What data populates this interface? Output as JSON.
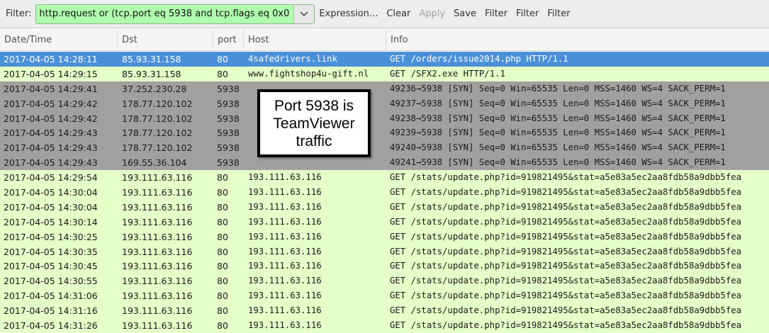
{
  "toolbar": {
    "filter_label": "Filter:",
    "filter_value": "http.request or (tcp.port eq 5938 and tcp.flags eq 0x0",
    "dropdown_icon": "chevron-down-icon",
    "buttons": [
      {
        "label": "Expression...",
        "enabled": true
      },
      {
        "label": "Clear",
        "enabled": true
      },
      {
        "label": "Apply",
        "enabled": false
      },
      {
        "label": "Save",
        "enabled": true
      },
      {
        "label": "Filter",
        "enabled": true
      },
      {
        "label": "Filter",
        "enabled": true
      },
      {
        "label": "Filter",
        "enabled": true
      }
    ]
  },
  "columns": [
    "Date/Time",
    "Dst",
    "port",
    "Host",
    "Info"
  ],
  "row_colors": {
    "selected": "#4a90d9",
    "http": "#e4ffc7",
    "tcp_syn": "#a0a0a0"
  },
  "rows": [
    {
      "date": "2017-04-05 14:28:11",
      "dst": "85.93.31.158",
      "port": "80",
      "host": "4safedrivers.link",
      "info": "GET /orders/issue2014.php HTTP/1.1",
      "style": "selected"
    },
    {
      "date": "2017-04-05 14:29:15",
      "dst": "85.93.31.158",
      "port": "80",
      "host": "www.fightshop4u-gift.nl",
      "info": "GET /SFX2.exe HTTP/1.1",
      "style": "http"
    },
    {
      "date": "2017-04-05 14:29:41",
      "dst": "37.252.230.28",
      "port": "5938",
      "host": "",
      "info": "49236→5938 [SYN] Seq=0 Win=65535 Len=0 MSS=1460 WS=4 SACK_PERM=1",
      "style": "tcp_syn"
    },
    {
      "date": "2017-04-05 14:29:42",
      "dst": "178.77.120.102",
      "port": "5938",
      "host": "",
      "info": "49237→5938 [SYN] Seq=0 Win=65535 Len=0 MSS=1460 WS=4 SACK_PERM=1",
      "style": "tcp_syn"
    },
    {
      "date": "2017-04-05 14:29:42",
      "dst": "178.77.120.102",
      "port": "5938",
      "host": "",
      "info": "49238→5938 [SYN] Seq=0 Win=65535 Len=0 MSS=1460 WS=4 SACK_PERM=1",
      "style": "tcp_syn"
    },
    {
      "date": "2017-04-05 14:29:43",
      "dst": "178.77.120.102",
      "port": "5938",
      "host": "",
      "info": "49239→5938 [SYN] Seq=0 Win=65535 Len=0 MSS=1460 WS=4 SACK_PERM=1",
      "style": "tcp_syn"
    },
    {
      "date": "2017-04-05 14:29:43",
      "dst": "178.77.120.102",
      "port": "5938",
      "host": "",
      "info": "49240→5938 [SYN] Seq=0 Win=65535 Len=0 MSS=1460 WS=4 SACK_PERM=1",
      "style": "tcp_syn"
    },
    {
      "date": "2017-04-05 14:29:43",
      "dst": "169.55.36.104",
      "port": "5938",
      "host": "",
      "info": "49241→5938 [SYN] Seq=0 Win=65535 Len=0 MSS=1460 WS=4 SACK_PERM=1",
      "style": "tcp_syn"
    },
    {
      "date": "2017-04-05 14:29:54",
      "dst": "193.111.63.116",
      "port": "80",
      "host": "193.111.63.116",
      "info": "GET /stats/update.php?id=919821495&stat=a5e83a5ec2aa8fdb58a9dbb5fea",
      "style": "http"
    },
    {
      "date": "2017-04-05 14:30:04",
      "dst": "193.111.63.116",
      "port": "80",
      "host": "193.111.63.116",
      "info": "GET /stats/update.php?id=919821495&stat=a5e83a5ec2aa8fdb58a9dbb5fea",
      "style": "http"
    },
    {
      "date": "2017-04-05 14:30:04",
      "dst": "193.111.63.116",
      "port": "80",
      "host": "193.111.63.116",
      "info": "GET /stats/update.php?id=919821495&stat=a5e83a5ec2aa8fdb58a9dbb5fea",
      "style": "http"
    },
    {
      "date": "2017-04-05 14:30:14",
      "dst": "193.111.63.116",
      "port": "80",
      "host": "193.111.63.116",
      "info": "GET /stats/update.php?id=919821495&stat=a5e83a5ec2aa8fdb58a9dbb5fea",
      "style": "http"
    },
    {
      "date": "2017-04-05 14:30:25",
      "dst": "193.111.63.116",
      "port": "80",
      "host": "193.111.63.116",
      "info": "GET /stats/update.php?id=919821495&stat=a5e83a5ec2aa8fdb58a9dbb5fea",
      "style": "http"
    },
    {
      "date": "2017-04-05 14:30:35",
      "dst": "193.111.63.116",
      "port": "80",
      "host": "193.111.63.116",
      "info": "GET /stats/update.php?id=919821495&stat=a5e83a5ec2aa8fdb58a9dbb5fea",
      "style": "http"
    },
    {
      "date": "2017-04-05 14:30:45",
      "dst": "193.111.63.116",
      "port": "80",
      "host": "193.111.63.116",
      "info": "GET /stats/update.php?id=919821495&stat=a5e83a5ec2aa8fdb58a9dbb5fea",
      "style": "http"
    },
    {
      "date": "2017-04-05 14:30:55",
      "dst": "193.111.63.116",
      "port": "80",
      "host": "193.111.63.116",
      "info": "GET /stats/update.php?id=919821495&stat=a5e83a5ec2aa8fdb58a9dbb5fea",
      "style": "http"
    },
    {
      "date": "2017-04-05 14:31:06",
      "dst": "193.111.63.116",
      "port": "80",
      "host": "193.111.63.116",
      "info": "GET /stats/update.php?id=919821495&stat=a5e83a5ec2aa8fdb58a9dbb5fea",
      "style": "http"
    },
    {
      "date": "2017-04-05 14:31:16",
      "dst": "193.111.63.116",
      "port": "80",
      "host": "193.111.63.116",
      "info": "GET /stats/update.php?id=919821495&stat=a5e83a5ec2aa8fdb58a9dbb5fea",
      "style": "http"
    },
    {
      "date": "2017-04-05 14:31:26",
      "dst": "193.111.63.116",
      "port": "80",
      "host": "193.111.63.116",
      "info": "GET /stats/update.php?id=919821495&stat=a5e83a5ec2aa8fdb58a9dbb5fea",
      "style": "http"
    }
  ],
  "callout": {
    "lines": [
      "Port 5938 is",
      "TeamViewer",
      "traffic"
    ]
  }
}
